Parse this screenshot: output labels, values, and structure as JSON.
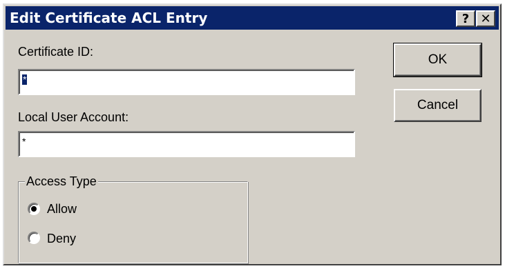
{
  "window": {
    "title": "Edit Certificate ACL Entry",
    "help_label": "?",
    "close_label": "✕"
  },
  "certificate_id": {
    "label": "Certificate ID:",
    "value": "*"
  },
  "local_user_account": {
    "label": "Local User Account:",
    "value": "*"
  },
  "access_type": {
    "legend": "Access Type",
    "options": [
      {
        "label": "Allow",
        "selected": true
      },
      {
        "label": "Deny",
        "selected": false
      }
    ]
  },
  "buttons": {
    "ok_label": "OK",
    "cancel_label": "Cancel"
  },
  "colors": {
    "titlebar": "#0a246a",
    "dialog_face": "#d4d0c8",
    "selection": "#0a246a"
  }
}
